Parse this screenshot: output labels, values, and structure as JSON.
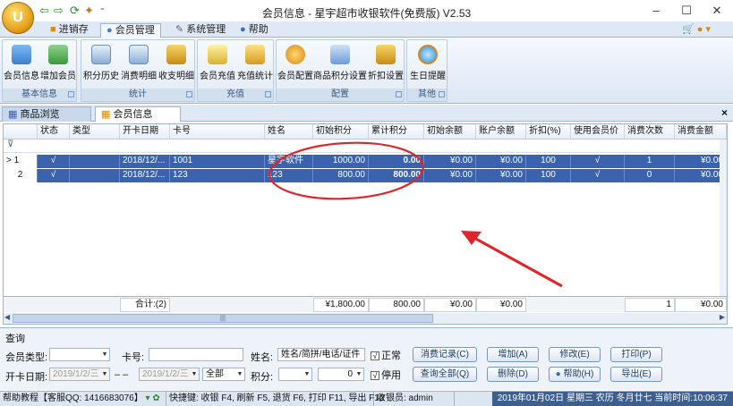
{
  "window": {
    "title": "会员信息 - 星宇超市收银软件(免费版) V2.53",
    "minimize": "–",
    "maximize": "☐",
    "close": "✕",
    "app_orb": "U"
  },
  "quick_access": {
    "back": "⇦",
    "forward": "⇨",
    "refresh": "⟳",
    "star": "✦",
    "more": "⁼"
  },
  "ribbon": {
    "tabs": [
      {
        "label": "进销存"
      },
      {
        "label": "会员管理"
      },
      {
        "label": "系统管理"
      },
      {
        "label": "帮助"
      }
    ],
    "groups": [
      {
        "caption": "基本信息",
        "buttons": [
          {
            "label": "会员信息"
          },
          {
            "label": "增加会员"
          }
        ]
      },
      {
        "caption": "统计",
        "buttons": [
          {
            "label": "积分历史"
          },
          {
            "label": "消费明细"
          },
          {
            "label": "收支明细"
          }
        ]
      },
      {
        "caption": "充值",
        "buttons": [
          {
            "label": "会员充值"
          },
          {
            "label": "充值统计"
          }
        ]
      },
      {
        "caption": "配置",
        "buttons": [
          {
            "label": "会员配置"
          },
          {
            "label": "商品积分设置"
          },
          {
            "label": "折扣设置"
          }
        ]
      },
      {
        "caption": "其他",
        "buttons": [
          {
            "label": "生日提醒"
          }
        ]
      }
    ]
  },
  "doc_tabs": [
    {
      "label": "商品浏览"
    },
    {
      "label": "会员信息"
    }
  ],
  "doc_close": "×",
  "grid": {
    "columns": [
      "状态",
      "类型",
      "开卡日期",
      "卡号",
      "姓名",
      "初始积分",
      "累计积分",
      "初始余额",
      "账户余额",
      "折扣(%)",
      "使用会员价",
      "消费次数",
      "消费金额"
    ],
    "filter_icon": "⊽",
    "rows": [
      {
        "indicator": "> 1",
        "status": "√",
        "type": "",
        "date": "2018/12/...",
        "card": "1001",
        "name": "星宇软件",
        "init_points": "1000.00",
        "total_points": "0.00",
        "init_balance": "¥0.00",
        "balance": "¥0.00",
        "discount": "100",
        "member_price": "√",
        "count": "1",
        "amount": "¥0.00"
      },
      {
        "indicator": "2",
        "status": "√",
        "type": "",
        "date": "2018/12/...",
        "card": "123",
        "name": "123",
        "init_points": "800.00",
        "total_points": "800.00",
        "init_balance": "¥0.00",
        "balance": "¥0.00",
        "discount": "100",
        "member_price": "√",
        "count": "0",
        "amount": "¥0.00"
      }
    ],
    "summary": {
      "label": "合计:(2)",
      "init_points": "¥1,800.00",
      "total_points": "800.00",
      "init_balance": "¥0.00",
      "balance": "¥0.00",
      "count": "1",
      "amount": "¥0.00"
    },
    "scroll_grip": "|||"
  },
  "query": {
    "title": "查询",
    "member_type_label": "会员类型:",
    "member_type_value": "",
    "card_label": "卡号:",
    "card_value": "",
    "name_label": "姓名:",
    "name_value": "姓名/简拼/电话/证件",
    "normal_label": "正常",
    "normal_checked": "√",
    "disabled_label": "停用",
    "disabled_checked": "√",
    "open_date_label": "开卡日期:",
    "date_from": "2019/1/2/三",
    "date_sep": "– –",
    "date_to": "2019/1/2/三",
    "range_value": "全部",
    "points_label": "积分:",
    "points_op": "",
    "points_value": "0",
    "buttons": {
      "consume_records": "消费记录(C)",
      "query_all": "查询全部(Q)",
      "add": "增加(A)",
      "delete": "删除(D)",
      "modify": "修改(E)",
      "help": "帮助(H)",
      "print": "打印(P)",
      "export": "导出(E)"
    }
  },
  "status": {
    "help": "帮助教程【客服QQ: 1416683076】",
    "shortcuts": "快捷键: 收银 F4, 刷新 F5, 退货 F6, 打印 F11, 导出 F12",
    "cashier": "收银员: admin",
    "datetime": "2019年01月02日 星期三 农历 冬月廿七 当前时间:10:06:37"
  },
  "colors": {
    "selection": "#3a62ad",
    "ribbon": "#dce7f4",
    "annotation": "#e0252b"
  }
}
